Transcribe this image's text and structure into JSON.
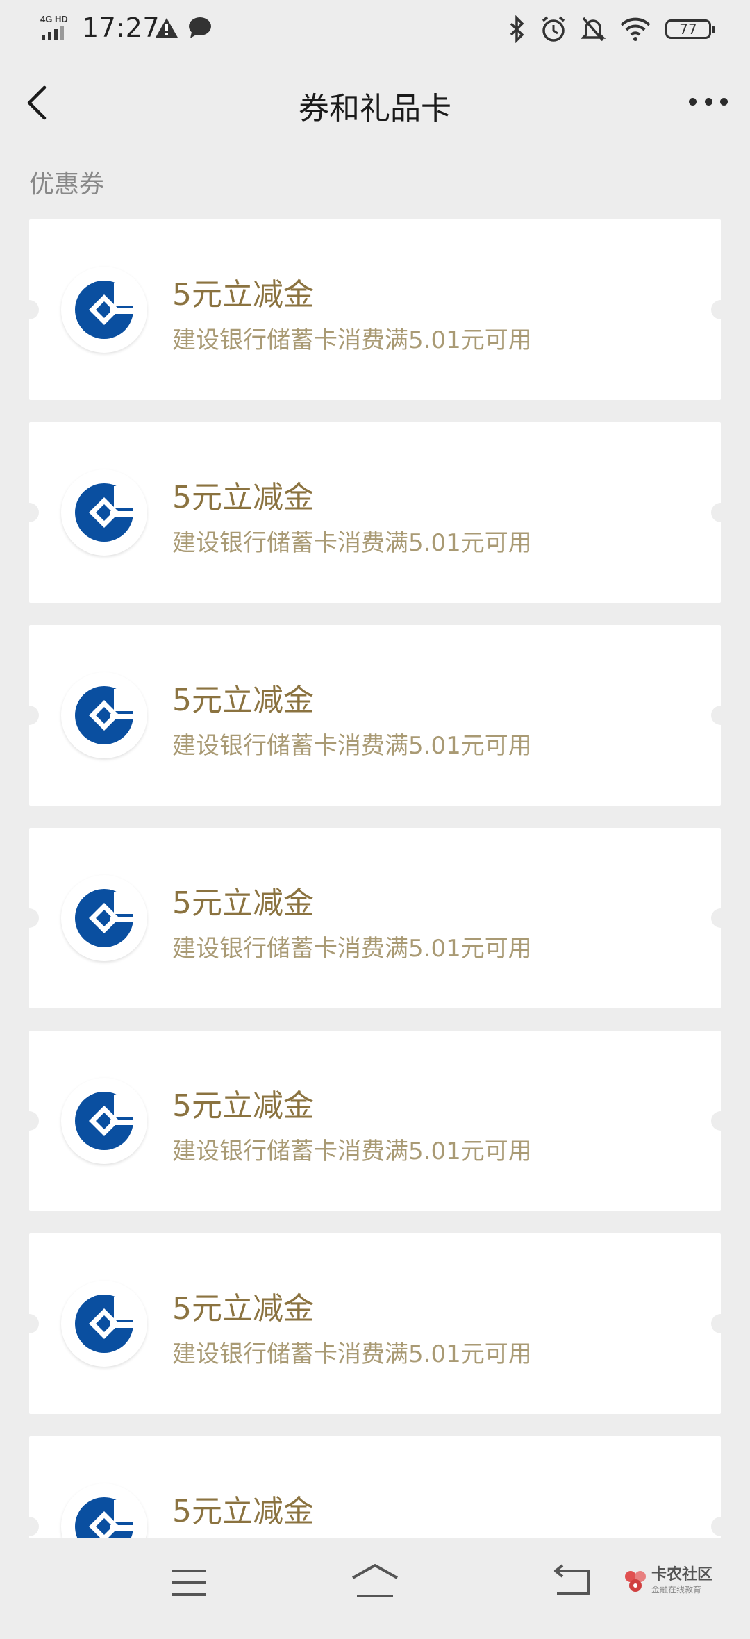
{
  "status_bar": {
    "network": "4G HD",
    "time": "17:27",
    "battery": "77"
  },
  "header": {
    "title": "券和礼品卡"
  },
  "section": {
    "label": "优惠券"
  },
  "coupons": [
    {
      "title": "5元立减金",
      "desc": "建设银行储蓄卡消费满5.01元可用"
    },
    {
      "title": "5元立减金",
      "desc": "建设银行储蓄卡消费满5.01元可用"
    },
    {
      "title": "5元立减金",
      "desc": "建设银行储蓄卡消费满5.01元可用"
    },
    {
      "title": "5元立减金",
      "desc": "建设银行储蓄卡消费满5.01元可用"
    },
    {
      "title": "5元立减金",
      "desc": "建设银行储蓄卡消费满5.01元可用"
    },
    {
      "title": "5元立减金",
      "desc": "建设银行储蓄卡消费满5.01元可用"
    },
    {
      "title": "5元立减金",
      "desc": ""
    }
  ],
  "watermark": {
    "name": "卡农社区",
    "tagline": "金融在线教育"
  },
  "colors": {
    "background": "#ededed",
    "coupon_title": "#8b7340",
    "coupon_desc": "#a99a74",
    "bank_logo": "#0a4fa0"
  },
  "icons": {
    "back": "chevron-left-icon",
    "more": "more-dots-icon",
    "bank": "ccb-logo-icon"
  }
}
